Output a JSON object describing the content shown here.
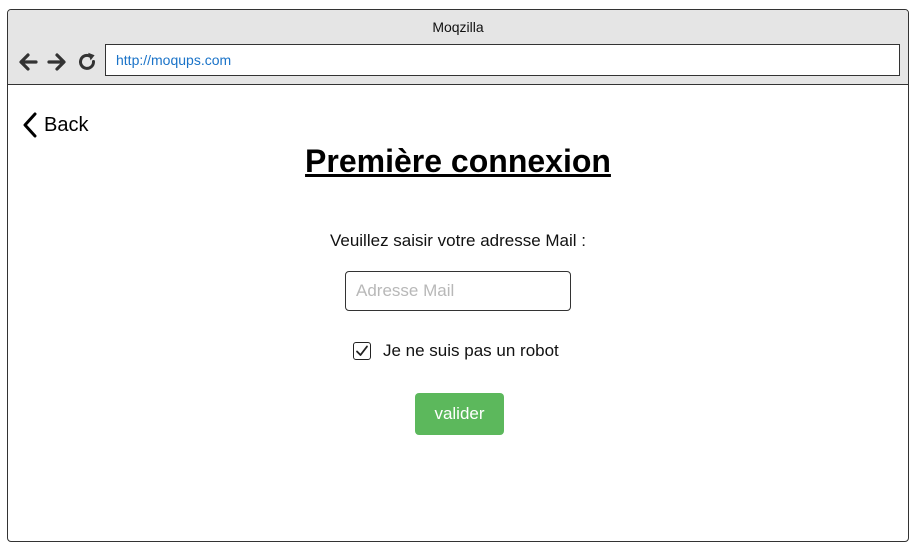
{
  "browser": {
    "window_title": "Moqzilla",
    "url": "http://moqups.com",
    "nav_icons": [
      "back-arrow-icon",
      "forward-arrow-icon",
      "reload-icon"
    ]
  },
  "page": {
    "back_label": "Back",
    "title": "Première connexion",
    "email_prompt": "Veuillez saisir votre adresse Mail :",
    "email_placeholder": "Adresse Mail",
    "email_value": "",
    "robot_checkbox_label": "Je ne suis pas un robot",
    "robot_checked": true,
    "submit_label": "valider"
  },
  "colors": {
    "chrome_background": "#e5e5e5",
    "url_text": "#1a73c8",
    "submit_button": "#5cb85c",
    "placeholder_text": "#b8b8b8"
  }
}
